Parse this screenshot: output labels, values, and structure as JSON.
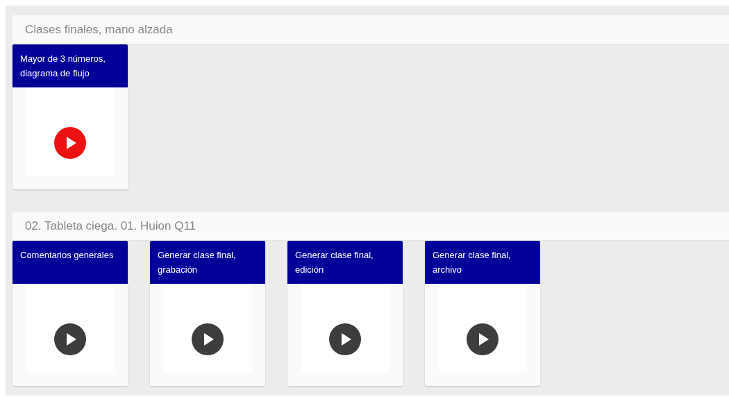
{
  "sections": [
    {
      "title": "Clases finales, mano alzada",
      "cards": [
        {
          "title": "Mayor de 3 números, diagrama de flujo",
          "color": "#ee1111"
        }
      ]
    },
    {
      "title": "02. Tableta ciega. 01. Huion Q11",
      "cards": [
        {
          "title": "Comentarios generales",
          "color": "#3d3d3d"
        },
        {
          "title": "Generar clase final, grabación",
          "color": "#3d3d3d"
        },
        {
          "title": "Generar clase final, edición",
          "color": "#3d3d3d"
        },
        {
          "title": "Generar clase final, archivo",
          "color": "#3d3d3d"
        }
      ]
    }
  ]
}
